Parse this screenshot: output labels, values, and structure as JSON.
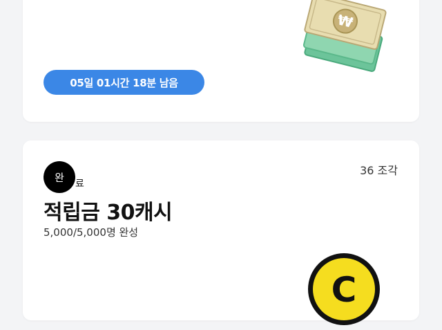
{
  "top_card": {
    "timer_text": "05일 01시간 18분 남음",
    "illustration_icon": "money-bills-icon",
    "currency_symbol": "₩"
  },
  "reward_card": {
    "pieces_text": "36 조각",
    "badge_text": "완",
    "badge_tail_text": "료",
    "title": "적립금 30캐시",
    "progress_text": "5,000/5,000명 완성",
    "coin_icon": "cash-coin-icon",
    "coin_letter": "C"
  },
  "colors": {
    "accent_blue": "#3b87e6",
    "coin_yellow": "#f5dd1f",
    "background": "#f3f4f6"
  }
}
